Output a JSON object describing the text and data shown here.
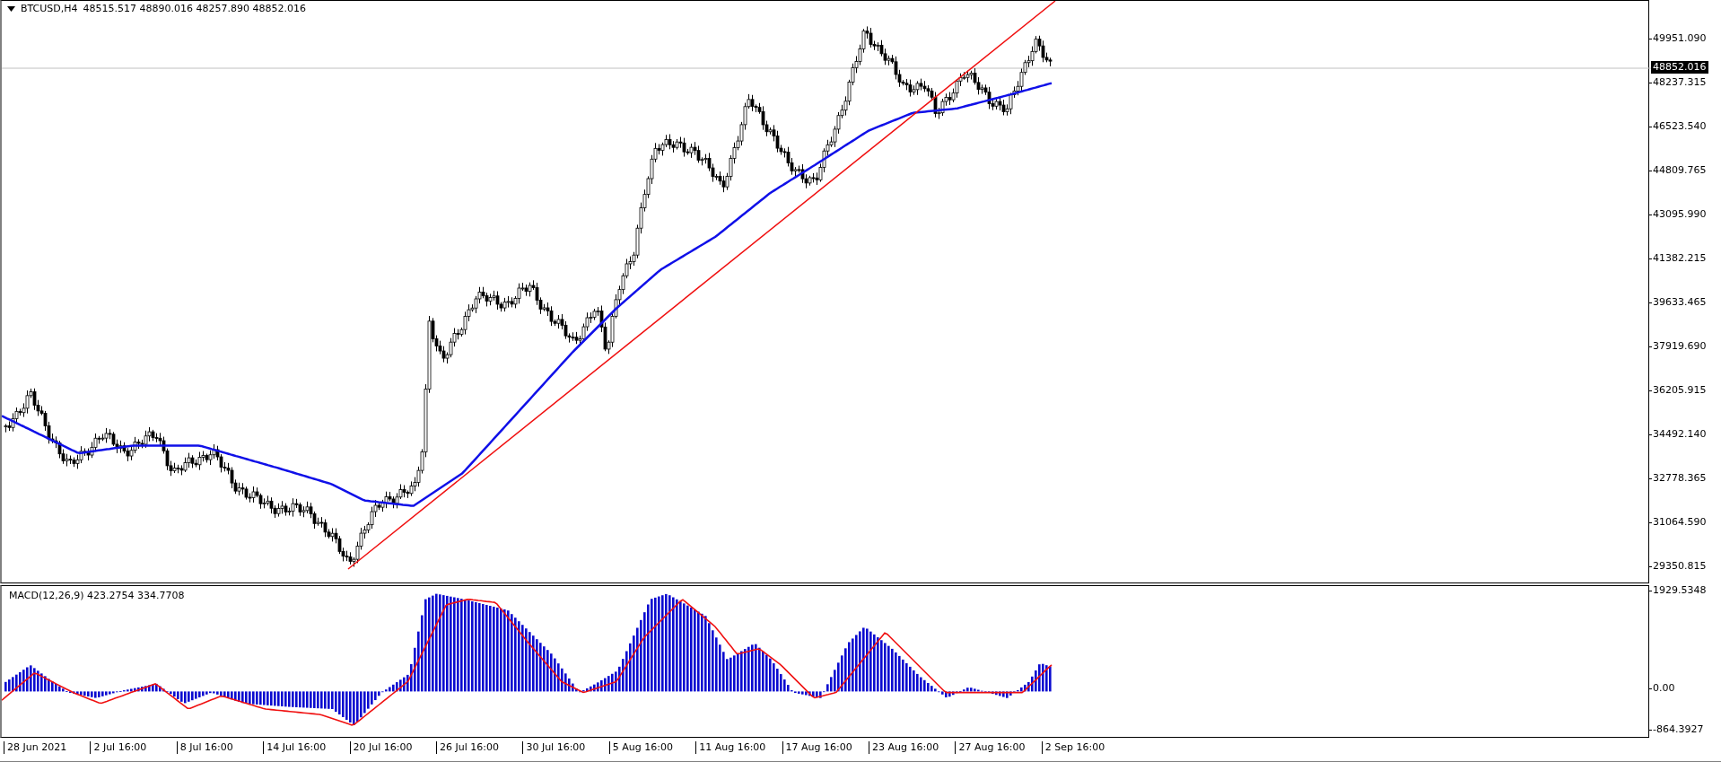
{
  "chart": {
    "header": {
      "symbol": "BTCUSD,H4",
      "ohlc": "48515.517 48890.016 48257.890 48852.016"
    },
    "price_axis": [
      "49951.090",
      "48237.315",
      "46523.540",
      "44809.765",
      "43095.990",
      "41382.215",
      "39633.465",
      "37919.690",
      "36205.915",
      "34492.140",
      "32778.365",
      "31064.590",
      "29350.815"
    ],
    "current_price": "48852.016"
  },
  "macd": {
    "label": "MACD(12,26,9) 423.2754 334.7708",
    "axis": [
      "1929.5348",
      "0.00",
      "-864.3927"
    ]
  },
  "time_axis": [
    "28 Jun 2021",
    "2 Jul 16:00",
    "8 Jul 16:00",
    "14 Jul 16:00",
    "20 Jul 16:00",
    "26 Jul 16:00",
    "30 Jul 16:00",
    "5 Aug 16:00",
    "11 Aug 16:00",
    "17 Aug 16:00",
    "23 Aug 16:00",
    "27 Aug 16:00",
    "2 Sep 16:00"
  ]
}
